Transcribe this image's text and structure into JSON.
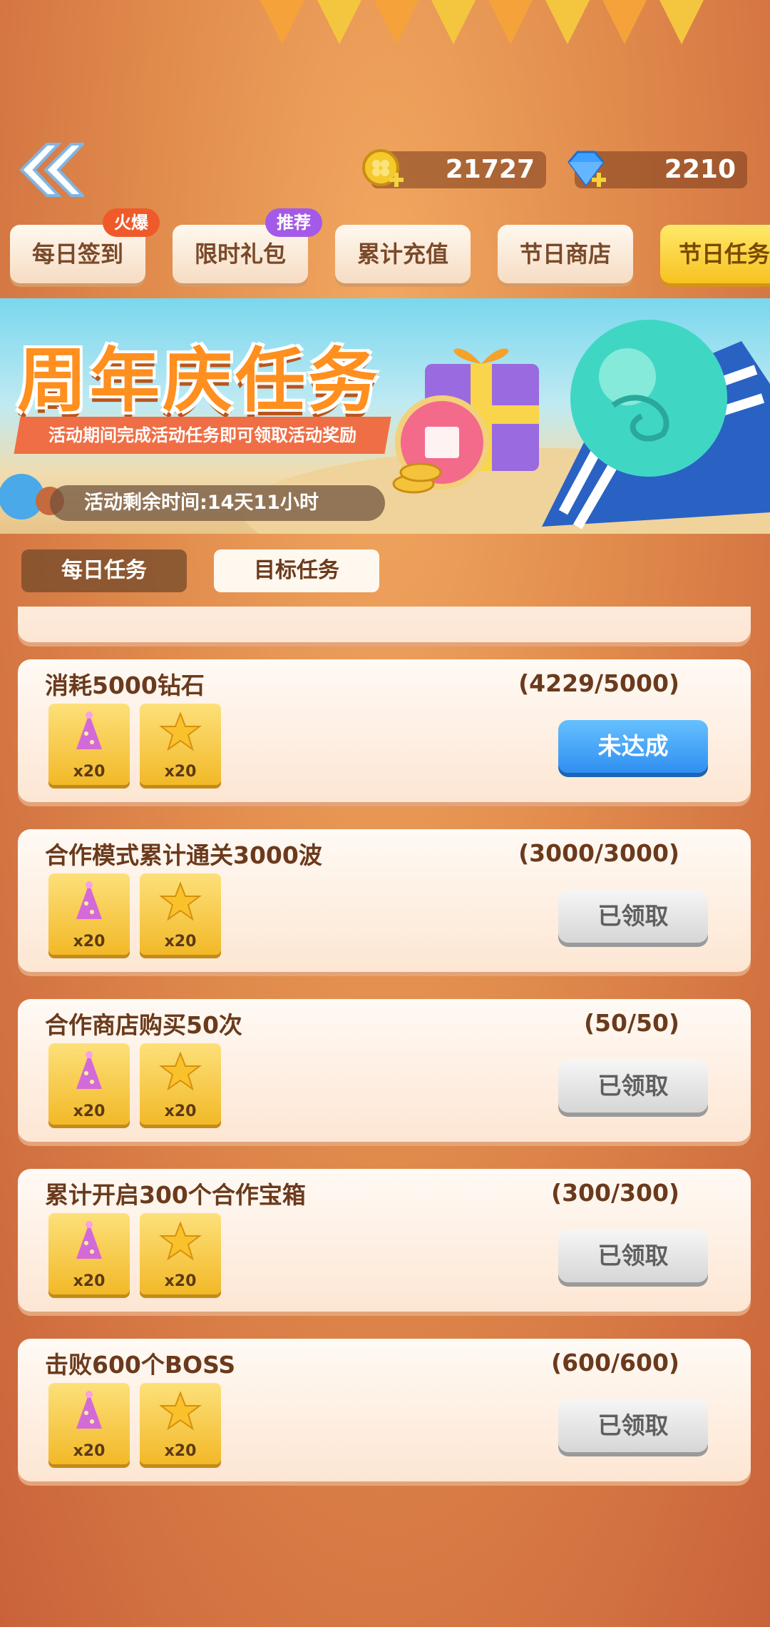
{
  "currencies": [
    {
      "icon": "clover-coin-icon",
      "value": "21727"
    },
    {
      "icon": "diamond-icon",
      "value": "2210"
    }
  ],
  "tabs": [
    {
      "label": "每日签到",
      "badge": "火爆",
      "badge_color": "#f05a2b"
    },
    {
      "label": "限时礼包",
      "badge": "推荐",
      "badge_color": "#a45ae8"
    },
    {
      "label": "累计充值"
    },
    {
      "label": "节日商店"
    },
    {
      "label": "节日任务",
      "active": true
    }
  ],
  "banner": {
    "title": "周年庆任务",
    "subtitle": "活动期间完成活动任务即可领取活动奖励",
    "timer": "活动剩余时间:14天11小时"
  },
  "subtabs": [
    {
      "label": "每日任务",
      "active": true
    },
    {
      "label": "目标任务",
      "active": false
    }
  ],
  "tasks": [
    {
      "title": "消耗5000钻石",
      "progress": "(4229/5000)",
      "button": "未达成",
      "button_state": "incomplete",
      "rewards": [
        {
          "icon": "party-hat-icon",
          "qty": "x20"
        },
        {
          "icon": "star-icon",
          "qty": "x20"
        }
      ]
    },
    {
      "title": "合作模式累计通关3000波",
      "progress": "(3000/3000)",
      "button": "已领取",
      "button_state": "claimed",
      "rewards": [
        {
          "icon": "party-hat-icon",
          "qty": "x20"
        },
        {
          "icon": "star-icon",
          "qty": "x20"
        }
      ]
    },
    {
      "title": "合作商店购买50次",
      "progress": "(50/50)",
      "button": "已领取",
      "button_state": "claimed",
      "rewards": [
        {
          "icon": "party-hat-icon",
          "qty": "x20"
        },
        {
          "icon": "star-icon",
          "qty": "x20"
        }
      ]
    },
    {
      "title": "累计开启300个合作宝箱",
      "progress": "(300/300)",
      "button": "已领取",
      "button_state": "claimed",
      "rewards": [
        {
          "icon": "party-hat-icon",
          "qty": "x20"
        },
        {
          "icon": "star-icon",
          "qty": "x20"
        }
      ]
    },
    {
      "title": "击败600个BOSS",
      "progress": "(600/600)",
      "button": "已领取",
      "button_state": "claimed",
      "rewards": [
        {
          "icon": "party-hat-icon",
          "qty": "x20"
        },
        {
          "icon": "star-icon",
          "qty": "x20"
        }
      ]
    }
  ],
  "colors": {
    "accent_yellow": "#f7c221",
    "button_blue": "#2f8ff0",
    "button_gray": "#d6d6d6",
    "text_brown": "#6b3a1c"
  }
}
